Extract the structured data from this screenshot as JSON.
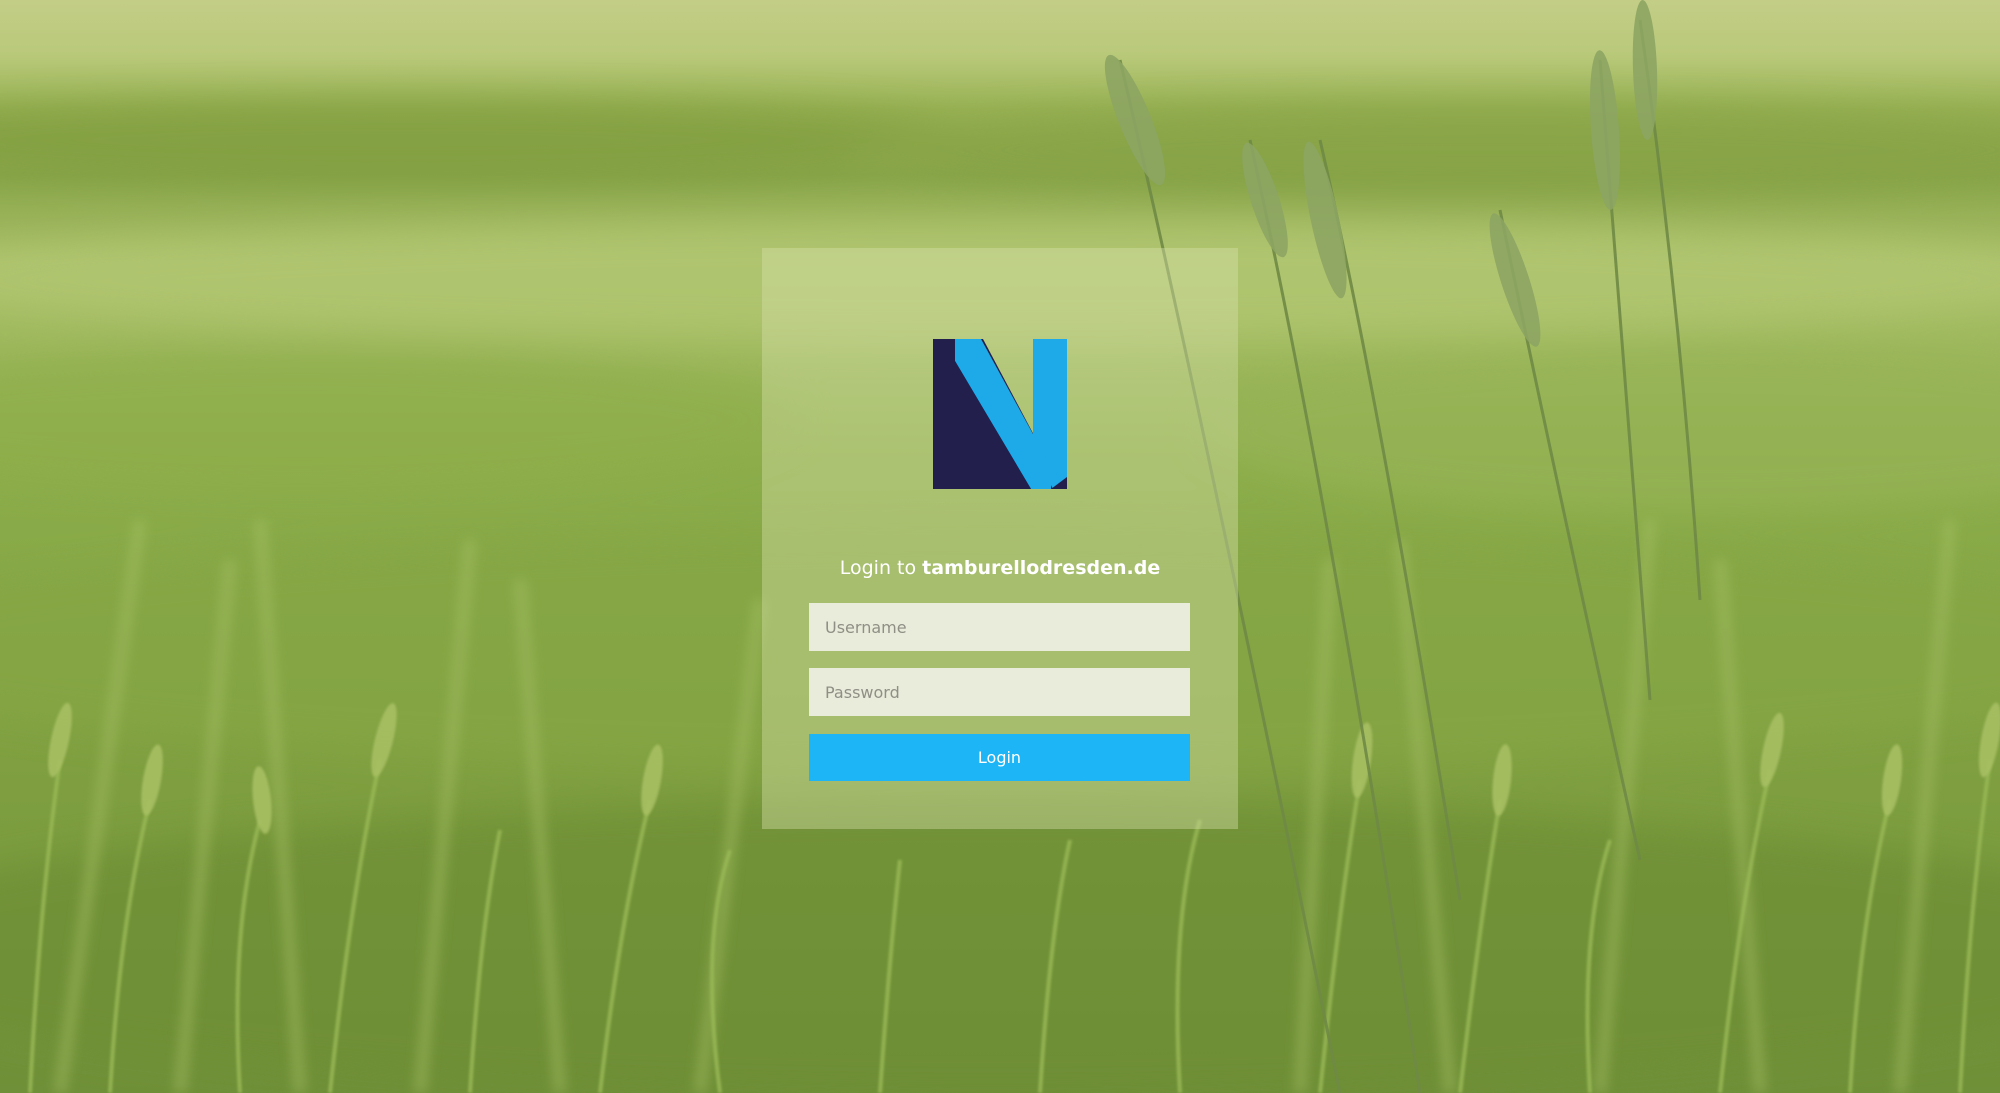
{
  "login": {
    "title_prefix": "Login to",
    "site_name": "tamburellodresden.de",
    "username_placeholder": "Username",
    "password_placeholder": "Password",
    "button_label": "Login"
  },
  "logo": {
    "icon": "n-logo-icon",
    "colors": {
      "dark": "#221f4d",
      "light": "#1ea9e8"
    }
  },
  "colors": {
    "accent": "#1db5f5",
    "card_background": "rgba(214,224,170,0.42)",
    "field_background": "#f3f3e9"
  }
}
